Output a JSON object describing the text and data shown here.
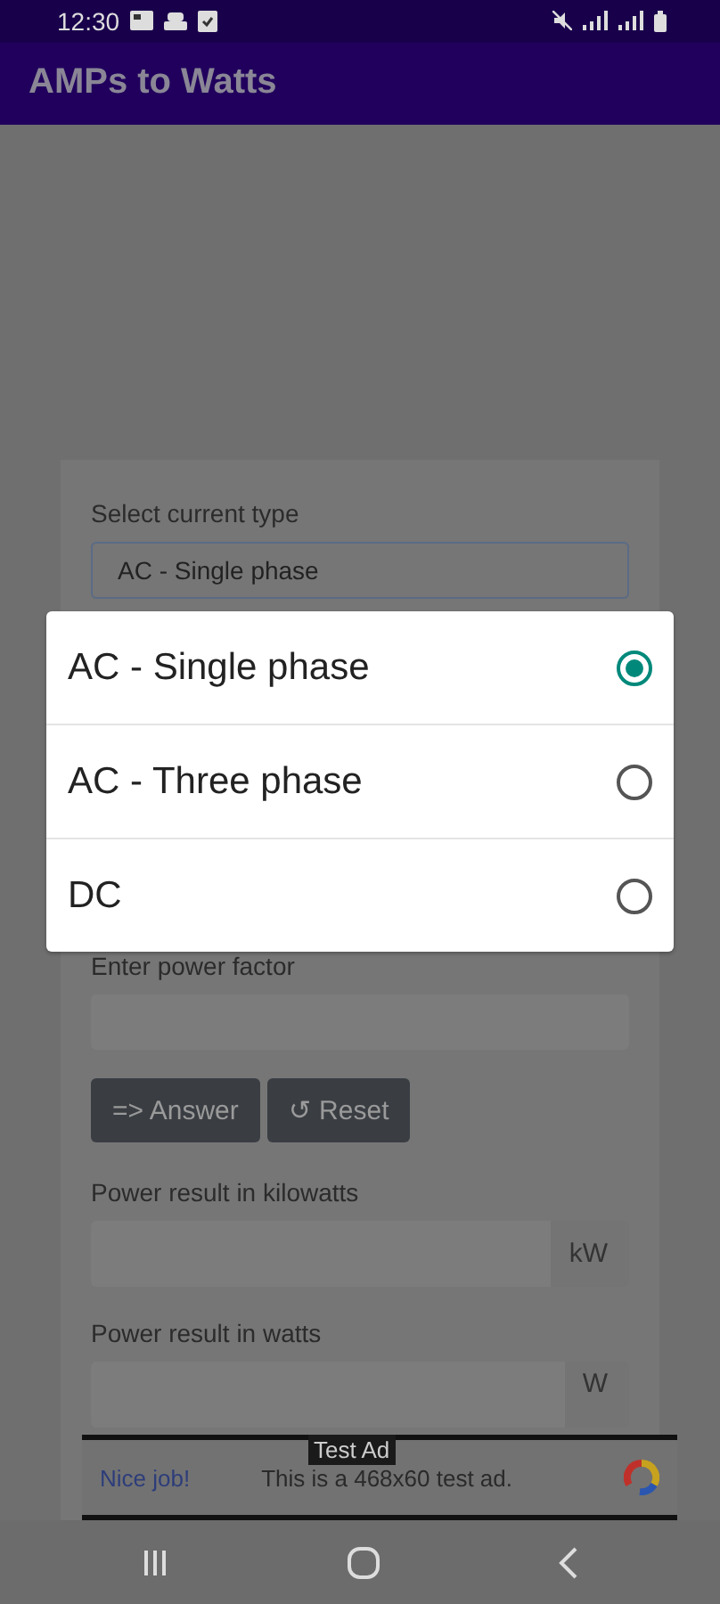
{
  "status_bar": {
    "time": "12:30"
  },
  "app_bar": {
    "title": "AMPs to Watts"
  },
  "form": {
    "current_type_label": "Select current type",
    "current_type_value": "AC - Single phase",
    "power_factor_label": "Enter power factor",
    "buttons": [
      {
        "label": "=> Answer"
      },
      {
        "label": "↺ Reset"
      }
    ],
    "results": [
      {
        "label": "Power result in kilowatts",
        "unit": "kW"
      },
      {
        "label": "Power result in watts",
        "unit": "W"
      }
    ]
  },
  "dialog": {
    "options": [
      {
        "label": "AC - Single phase",
        "selected": true
      },
      {
        "label": "AC - Three phase",
        "selected": false
      },
      {
        "label": "DC",
        "selected": false
      }
    ]
  },
  "ad": {
    "badge": "Test Ad",
    "headline": "Nice job!",
    "text": "This is a 468x60 test ad."
  }
}
